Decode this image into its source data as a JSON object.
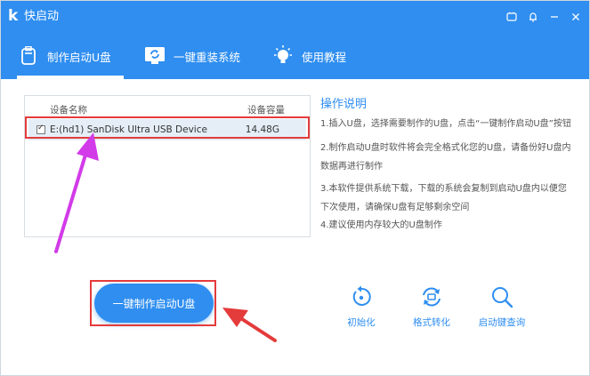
{
  "app": {
    "logo_letter": "k",
    "title": "快启动"
  },
  "window_controls": [
    {
      "name": "skin-icon"
    },
    {
      "name": "bell-icon"
    },
    {
      "name": "minimize-icon",
      "glyph": "−"
    },
    {
      "name": "close-icon",
      "glyph": "×"
    }
  ],
  "tabs": [
    {
      "label": "制作启动U盘",
      "icon": "usb-icon",
      "active": true
    },
    {
      "label": "一键重装系统",
      "icon": "reinstall-icon",
      "active": false
    },
    {
      "label": "使用教程",
      "icon": "bulb-icon",
      "active": false
    }
  ],
  "device_table": {
    "columns": [
      "设备名称",
      "设备容量"
    ],
    "rows": [
      {
        "name": "E:(hd1) SanDisk Ultra USB Device",
        "size": "14.48G",
        "checked": true
      }
    ]
  },
  "instructions": {
    "title": "操作说明",
    "items": [
      "1.插入U盘，选择需要制作的U盘，点击“一键制作启动U盘”按钮",
      "2.制作启动U盘时软件将会完全格式化您的U盘，请备份好U盘内数据再进行制作",
      "3.本软件提供系统下载，下载的系统会复制到启动U盘内以便您下次使用，请确保U盘有足够剩余空间",
      "4.建议使用内存较大的U盘制作"
    ]
  },
  "make_button": {
    "label": "一键制作启动U盘"
  },
  "tools": [
    {
      "label": "初始化",
      "icon": "reset-icon"
    },
    {
      "label": "格式转化",
      "icon": "convert-icon"
    },
    {
      "label": "启动键查询",
      "icon": "search-icon"
    }
  ],
  "colors": {
    "primary": "#2f8ef0",
    "annotation": "#e43b3b",
    "arrow": "#d23be8",
    "row_selected": "#e5eef7"
  }
}
